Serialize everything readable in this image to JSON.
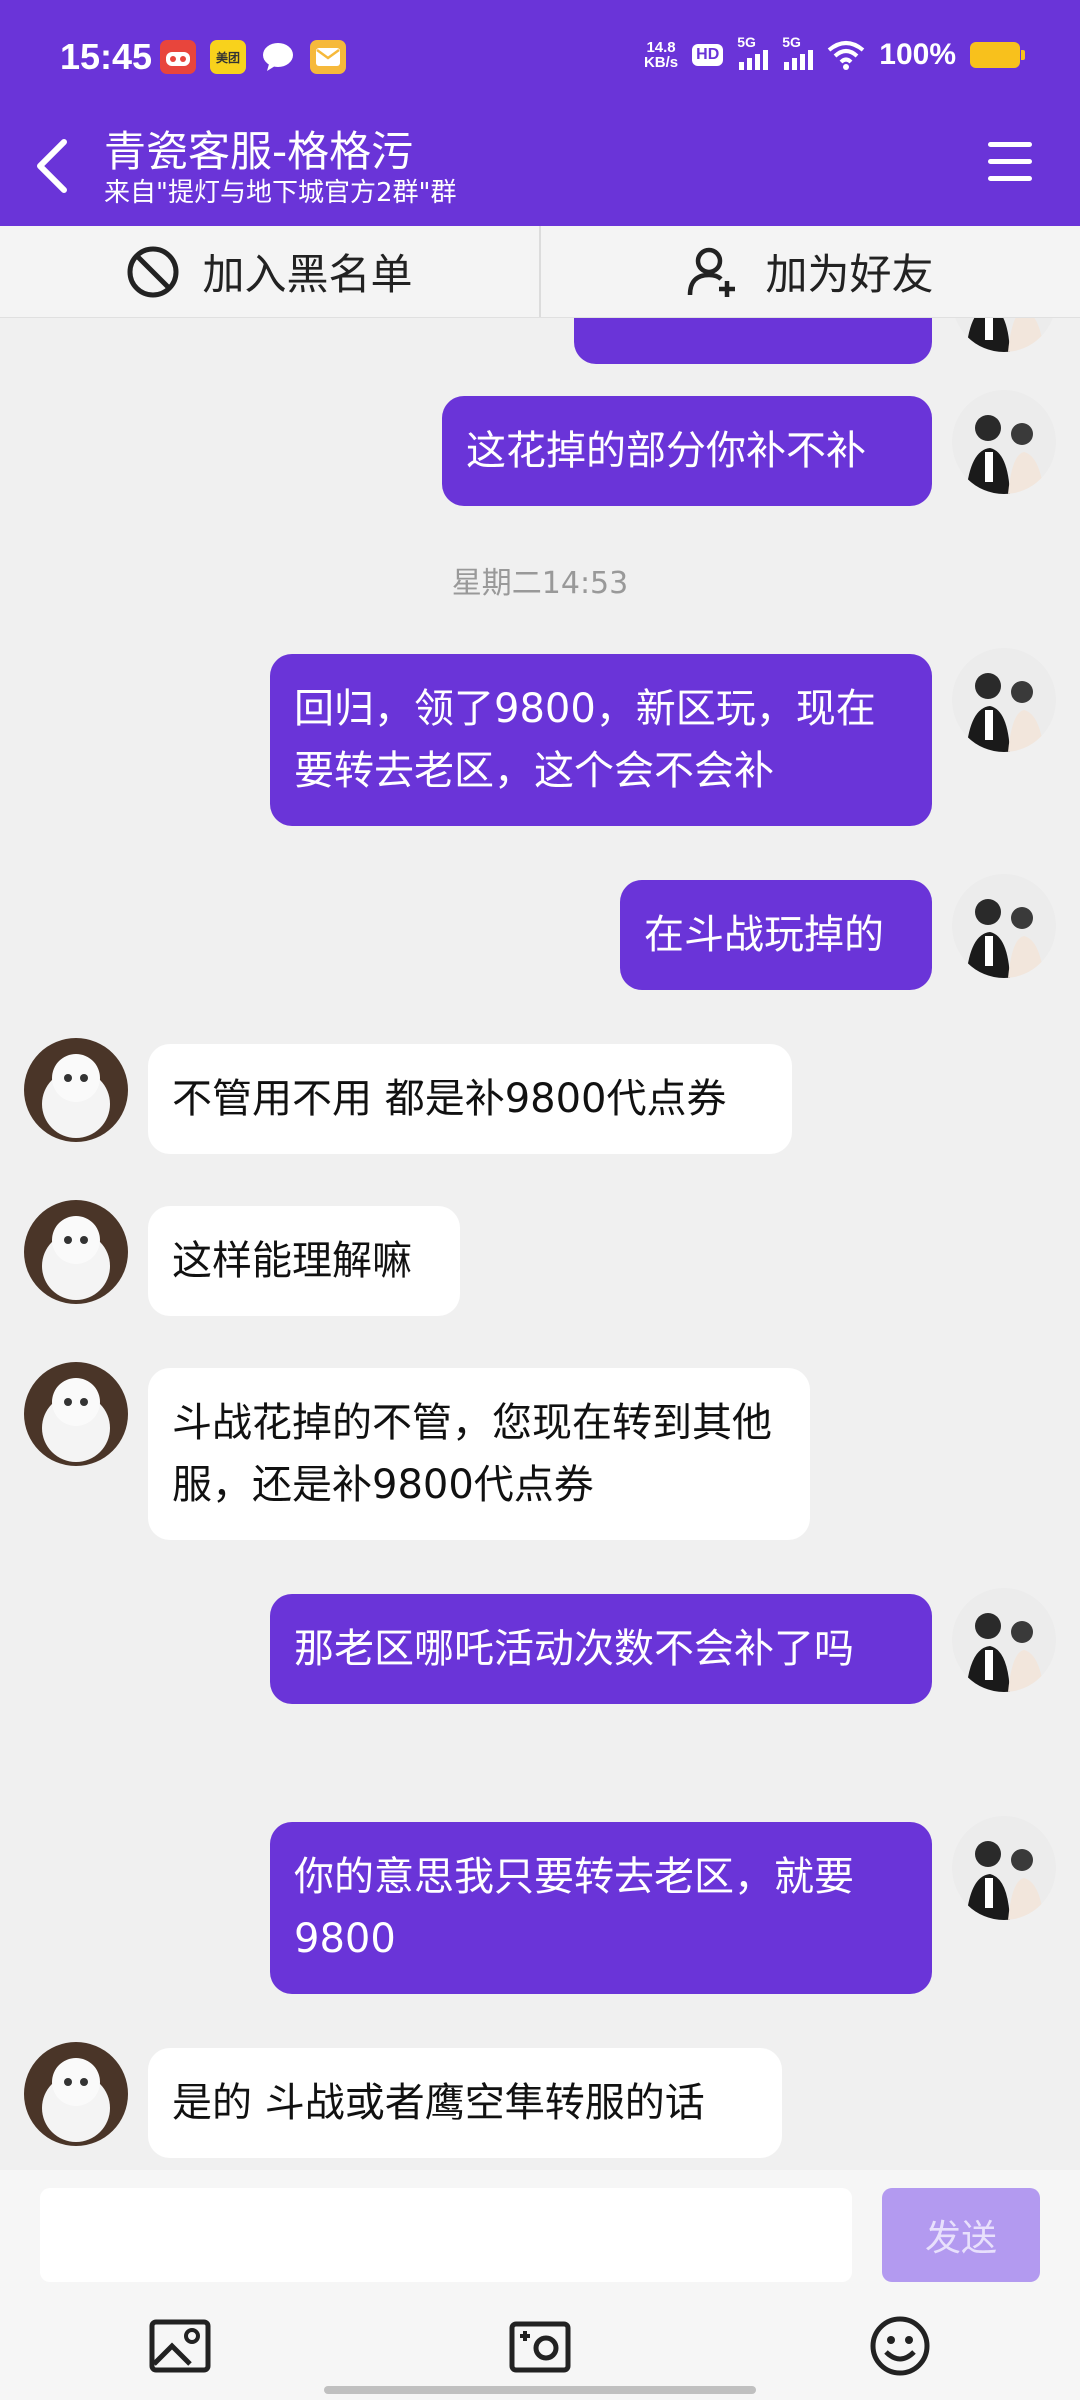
{
  "status_bar": {
    "time": "15:45",
    "notification_icons": [
      "game-app-icon",
      "meituan-icon",
      "chat-bubble-icon",
      "mail-icon"
    ],
    "meituan_label": "美团",
    "net_speed_value": "14.8",
    "net_speed_unit": "KB/s",
    "hd_label": "HD",
    "sim1_label": "5G",
    "sim2_label": "5G",
    "battery_percent": "100%"
  },
  "header": {
    "title": "青瓷客服-格格污",
    "subtitle": "来自\"提灯与地下城官方2群\"群",
    "background_color": "#6a34d8"
  },
  "actions": {
    "blacklist_label": "加入黑名单",
    "add_friend_label": "加为好友"
  },
  "messages": [
    {
      "side": "out",
      "text": "这花掉的部分你补不补"
    },
    {
      "timestamp": "星期二14:53"
    },
    {
      "side": "out",
      "text": "回归，领了9800，新区玩，现在要转去老区，这个会不会补"
    },
    {
      "side": "out",
      "text": "在斗战玩掉的"
    },
    {
      "side": "in",
      "text": "不管用不用 都是补9800代点券"
    },
    {
      "side": "in",
      "text": "这样能理解嘛"
    },
    {
      "side": "in",
      "text": "斗战花掉的不管，您现在转到其他服，还是补9800代点券"
    },
    {
      "side": "out",
      "text": "那老区哪吒活动次数不会补了吗"
    },
    {
      "side": "out",
      "text": "你的意思我只要转去老区，就要9800"
    },
    {
      "side": "in",
      "text": "是的 斗战或者鹰空隼转服的话"
    }
  ],
  "composer": {
    "input_value": "",
    "send_label": "发送",
    "tools": [
      "image-icon",
      "camera-icon",
      "emoji-icon"
    ]
  }
}
